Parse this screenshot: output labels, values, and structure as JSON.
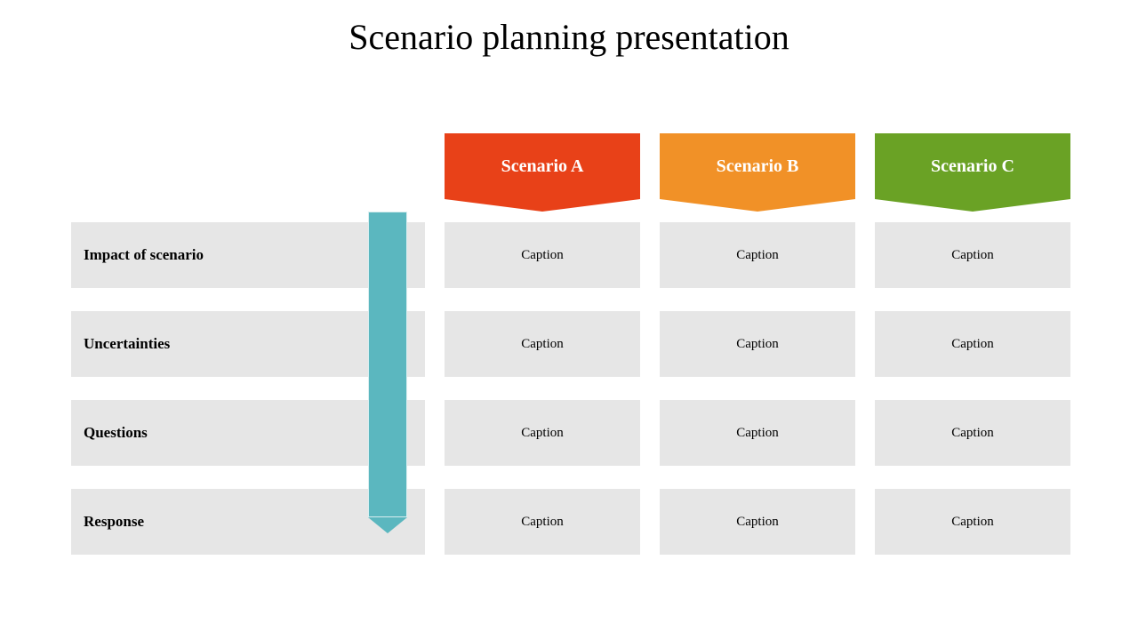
{
  "title": "Scenario planning presentation",
  "columns": [
    "Scenario A",
    "Scenario B",
    "Scenario C"
  ],
  "rows": [
    {
      "label": "Impact of scenario",
      "cells": [
        "Caption",
        "Caption",
        "Caption"
      ]
    },
    {
      "label": "Uncertainties",
      "cells": [
        "Caption",
        "Caption",
        "Caption"
      ]
    },
    {
      "label": "Questions",
      "cells": [
        "Caption",
        "Caption",
        "Caption"
      ]
    },
    {
      "label": "Response",
      "cells": [
        "Caption",
        "Caption",
        "Caption"
      ]
    }
  ],
  "colors": {
    "scenario_a": "#e84118",
    "scenario_b": "#f19127",
    "scenario_c": "#6aa225",
    "arrow": "#5bb7bf",
    "cell_bg": "#e6e6e6"
  }
}
